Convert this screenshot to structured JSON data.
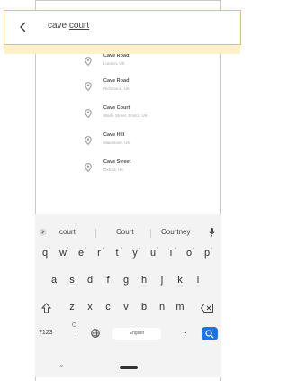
{
  "search": {
    "prefix": "cave",
    "query": "court"
  },
  "results": [
    {
      "title": "Cave Road",
      "subtitle": "London, UK"
    },
    {
      "title": "Cave Road",
      "subtitle": "Richmond, UK"
    },
    {
      "title": "Cave Court",
      "subtitle": "Wade Street, Bristol, UK"
    },
    {
      "title": "Cave Hill",
      "subtitle": "Maidstone, UK"
    },
    {
      "title": "Cave Street",
      "subtitle": "Oxford, UK"
    }
  ],
  "keyboard": {
    "suggestions": [
      "court",
      "Court",
      "Courtney"
    ],
    "row1": [
      "q",
      "w",
      "e",
      "r",
      "t",
      "y",
      "u",
      "i",
      "o",
      "p"
    ],
    "row1_hints": [
      "1",
      "2",
      "3",
      "4",
      "5",
      "6",
      "7",
      "8",
      "9",
      "0"
    ],
    "row2": [
      "a",
      "s",
      "d",
      "f",
      "g",
      "h",
      "j",
      "k",
      "l"
    ],
    "row3": [
      "z",
      "x",
      "c",
      "v",
      "b",
      "n",
      "m"
    ],
    "symbols_label": "?123",
    "comma": ",",
    "space_label": "English",
    "period": "."
  },
  "colors": {
    "accent": "#f3c43b",
    "highlight": "#fdf1c7",
    "search_key": "#1a73e8"
  }
}
